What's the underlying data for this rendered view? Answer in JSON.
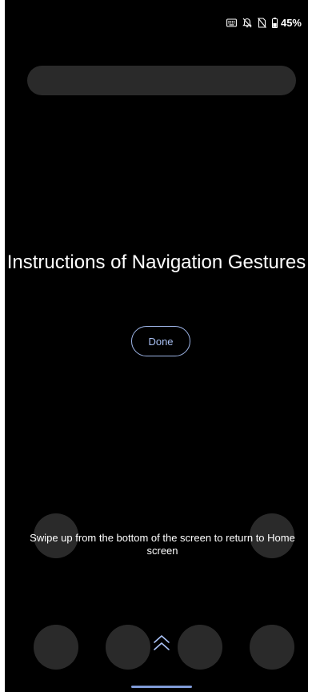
{
  "status_bar": {
    "battery_percent": "45%",
    "icons": [
      "keyboard-icon",
      "notifications-off-icon",
      "no-sim-icon",
      "battery-icon"
    ]
  },
  "main": {
    "title": "Instructions of Navigation Gestures",
    "done_label": "Done",
    "instruction": "Swipe up from the bottom of the screen to return to Home screen"
  },
  "colors": {
    "background": "#000000",
    "accent": "#a9c1f5",
    "placeholder_shape": "#2a2a2a"
  }
}
